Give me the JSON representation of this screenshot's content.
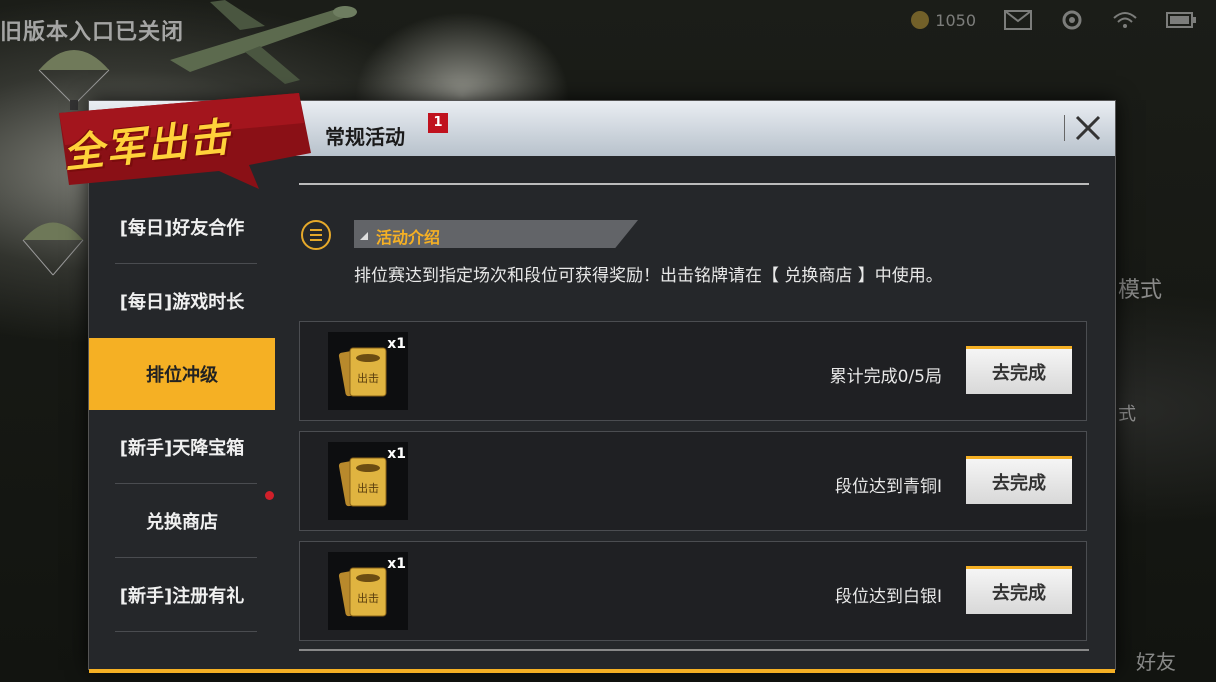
{
  "background": {
    "top_text": "旧版本入口已关闭",
    "coin_value": "1050",
    "side_texts": [
      "模式",
      "式",
      "好友"
    ]
  },
  "banner": {
    "text": "全军出击"
  },
  "modal": {
    "title": "常规活动",
    "badge_count": "1",
    "close_icon": "close-x-icon"
  },
  "sidebar": {
    "items": [
      {
        "label": "[每日]好友合作",
        "active": false
      },
      {
        "label": "[每日]游戏时长",
        "active": false
      },
      {
        "label": "排位冲级",
        "active": true
      },
      {
        "label": "[新手]天降宝箱",
        "active": false
      },
      {
        "label": "兑换商店",
        "active": false
      },
      {
        "label": "[新手]注册有礼",
        "active": false
      }
    ]
  },
  "intro": {
    "tab_label": "活动介绍",
    "description": "排位赛达到指定场次和段位可获得奖励！出击铭牌请在【 兑换商店 】中使用。"
  },
  "tasks": [
    {
      "reward_qty": "x1",
      "reward_label": "出击",
      "text": "累计完成0/5局",
      "button": "去完成"
    },
    {
      "reward_qty": "x1",
      "reward_label": "出击",
      "text": "段位达到青铜I",
      "button": "去完成"
    },
    {
      "reward_qty": "x1",
      "reward_label": "出击",
      "text": "段位达到白银I",
      "button": "去完成"
    }
  ],
  "colors": {
    "accent": "#f5b024",
    "badge": "#c0121e",
    "panel": "#25272a",
    "header": "#dfe4ea"
  }
}
